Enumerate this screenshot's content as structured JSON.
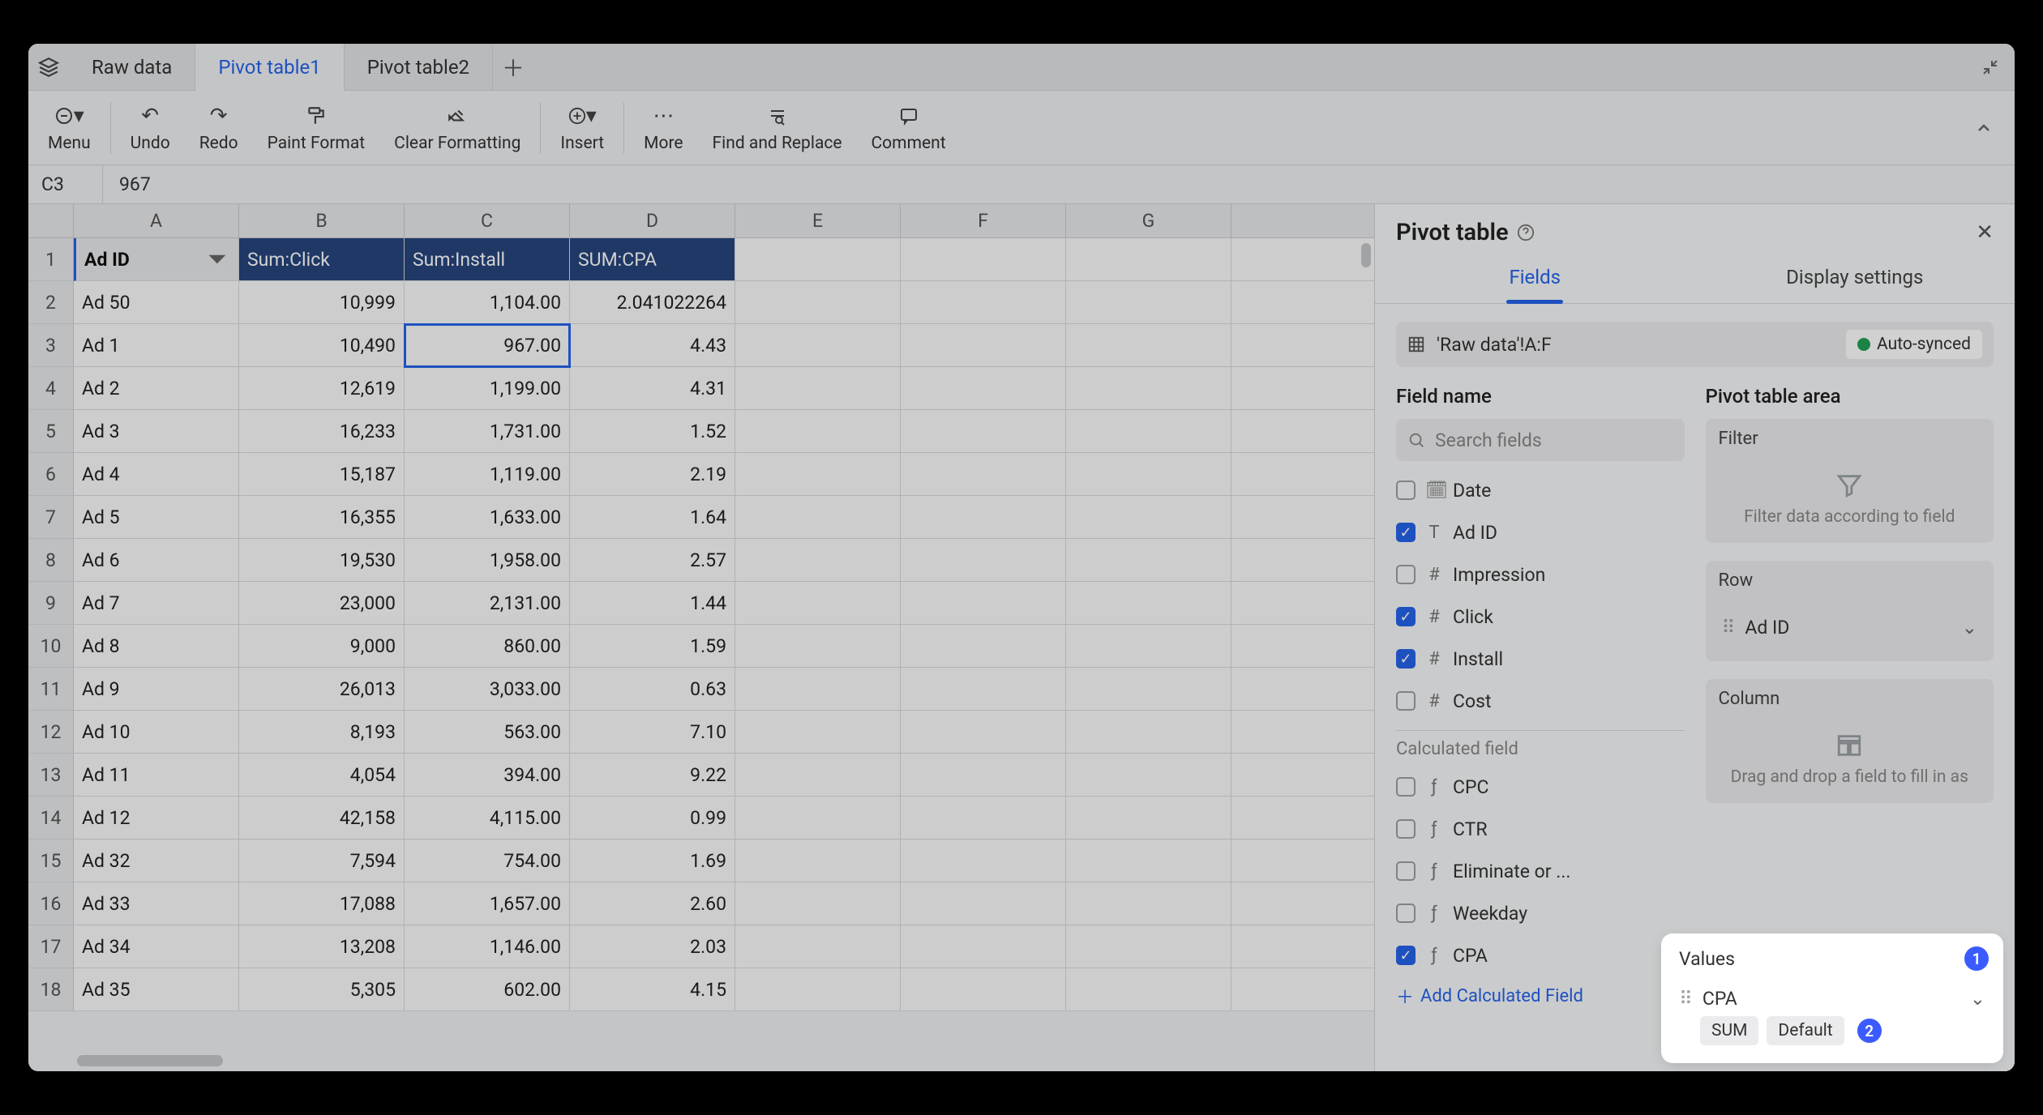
{
  "tabs": {
    "t0": "Raw data",
    "t1": "Pivot table1",
    "t2": "Pivot table2"
  },
  "toolbar": {
    "menu": "Menu",
    "undo": "Undo",
    "redo": "Redo",
    "paint": "Paint Format",
    "clear": "Clear Formatting",
    "insert": "Insert",
    "more": "More",
    "find": "Find and Replace",
    "comment": "Comment"
  },
  "fbar": {
    "ref": "C3",
    "val": "967"
  },
  "cols": [
    "A",
    "B",
    "C",
    "D",
    "E",
    "F",
    "G"
  ],
  "headers": {
    "c0": "Ad ID",
    "c1": "Sum:Click",
    "c2": "Sum:Install",
    "c3": "SUM:CPA"
  },
  "rows": [
    {
      "n": "1"
    },
    {
      "n": "2",
      "a": "Ad 50",
      "b": "10,999",
      "c": "1,104.00",
      "d": "2.041022264"
    },
    {
      "n": "3",
      "a": "Ad 1",
      "b": "10,490",
      "c": "967.00",
      "d": "4.43"
    },
    {
      "n": "4",
      "a": "Ad 2",
      "b": "12,619",
      "c": "1,199.00",
      "d": "4.31"
    },
    {
      "n": "5",
      "a": "Ad 3",
      "b": "16,233",
      "c": "1,731.00",
      "d": "1.52"
    },
    {
      "n": "6",
      "a": "Ad 4",
      "b": "15,187",
      "c": "1,119.00",
      "d": "2.19"
    },
    {
      "n": "7",
      "a": "Ad 5",
      "b": "16,355",
      "c": "1,633.00",
      "d": "1.64"
    },
    {
      "n": "8",
      "a": "Ad 6",
      "b": "19,530",
      "c": "1,958.00",
      "d": "2.57"
    },
    {
      "n": "9",
      "a": "Ad 7",
      "b": "23,000",
      "c": "2,131.00",
      "d": "1.44"
    },
    {
      "n": "10",
      "a": "Ad 8",
      "b": "9,000",
      "c": "860.00",
      "d": "1.59"
    },
    {
      "n": "11",
      "a": "Ad 9",
      "b": "26,013",
      "c": "3,033.00",
      "d": "0.63"
    },
    {
      "n": "12",
      "a": "Ad 10",
      "b": "8,193",
      "c": "563.00",
      "d": "7.10"
    },
    {
      "n": "13",
      "a": "Ad 11",
      "b": "4,054",
      "c": "394.00",
      "d": "9.22"
    },
    {
      "n": "14",
      "a": "Ad 12",
      "b": "42,158",
      "c": "4,115.00",
      "d": "0.99"
    },
    {
      "n": "15",
      "a": "Ad 32",
      "b": "7,594",
      "c": "754.00",
      "d": "1.69"
    },
    {
      "n": "16",
      "a": "Ad 33",
      "b": "17,088",
      "c": "1,657.00",
      "d": "2.60"
    },
    {
      "n": "17",
      "a": "Ad 34",
      "b": "13,208",
      "c": "1,146.00",
      "d": "2.03"
    },
    {
      "n": "18",
      "a": "Ad 35",
      "b": "5,305",
      "c": "602.00",
      "d": "4.15"
    }
  ],
  "panel": {
    "title": "Pivot table",
    "tab_fields": "Fields",
    "tab_display": "Display settings",
    "range": "'Raw data'!A:F",
    "auto": "Auto-synced",
    "fieldname": "Field name",
    "area": "Pivot table area",
    "search_ph": "Search fields",
    "fields": {
      "date": "Date",
      "adid": "Ad ID",
      "imp": "Impression",
      "click": "Click",
      "install": "Install",
      "cost": "Cost"
    },
    "calc_label": "Calculated field",
    "calc": {
      "cpc": "CPC",
      "ctr": "CTR",
      "elim": "Eliminate or ...",
      "weekday": "Weekday",
      "cpa": "CPA"
    },
    "addcalc": "Add Calculated Field",
    "filter_hd": "Filter",
    "filter_hint": "Filter data according to field",
    "row_hd": "Row",
    "row_item": "Ad ID",
    "col_hd": "Column",
    "col_hint": "Drag and drop a field to fill in as",
    "values_hd": "Values",
    "values_item": "CPA",
    "sum": "SUM",
    "def": "Default",
    "call1": "1",
    "call2": "2"
  }
}
